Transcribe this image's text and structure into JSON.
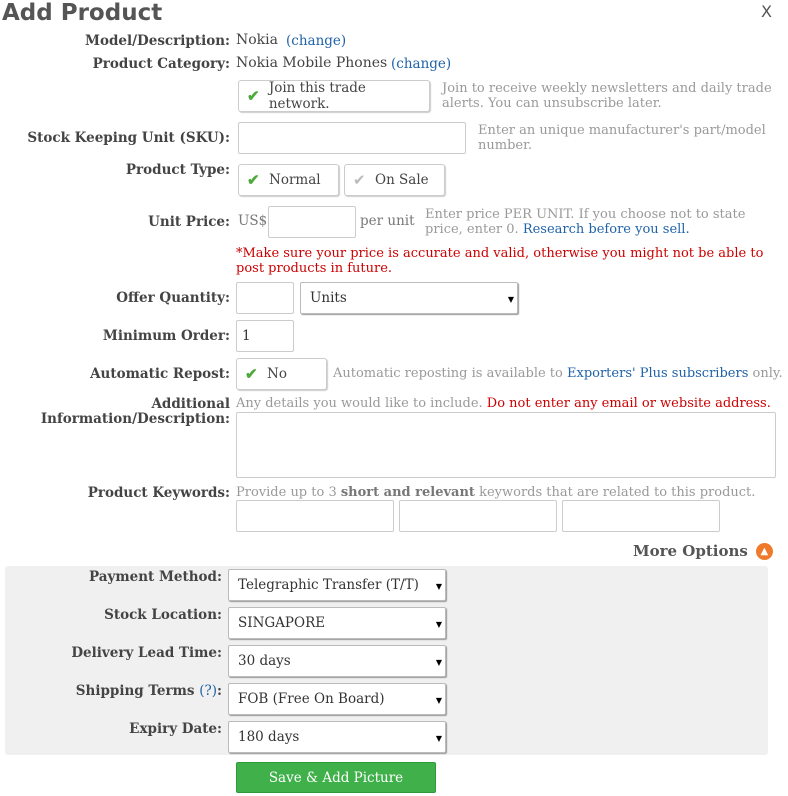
{
  "header": {
    "title": "Add Product",
    "close_label": "X"
  },
  "model": {
    "label": "Model/Description:",
    "value": "Nokia",
    "change": "(change)"
  },
  "category": {
    "label": "Product Category:",
    "value": "Nokia Mobile Phones",
    "change": "(change)"
  },
  "join": {
    "label": "Join this trade network.",
    "hint": "Join to receive weekly newsletters and daily trade alerts. You can unsubscribe later."
  },
  "sku": {
    "label": "Stock Keeping Unit (SKU):",
    "value": "",
    "hint": "Enter an unique manufacturer's part/model number."
  },
  "product_type": {
    "label": "Product Type:",
    "options": [
      "Normal",
      "On Sale"
    ],
    "selected": "Normal"
  },
  "unit_price": {
    "label": "Unit Price:",
    "currency": "US$",
    "value": "",
    "per_unit": "per unit",
    "hint": "Enter price PER UNIT. If you choose not to state price, enter 0.",
    "research_link": "Research before you sell.",
    "warning": "*Make sure your price is accurate and valid, otherwise you might not be able to post products in future."
  },
  "offer_quantity": {
    "label": "Offer Quantity:",
    "value": "",
    "unit": "Units"
  },
  "minimum_order": {
    "label": "Minimum Order:",
    "value": "1"
  },
  "repost": {
    "label": "Automatic Repost:",
    "value": "No",
    "hint_before": "Automatic reposting is available to",
    "link": "Exporters' Plus subscribers",
    "hint_after": "only."
  },
  "additional": {
    "label_line1": "Additional",
    "label_line2": "Information/Description:",
    "hint": "Any details you would like to include.",
    "warning": "Do not enter any email or website address.",
    "value": ""
  },
  "keywords": {
    "label": "Product Keywords:",
    "hint_before": "Provide up to 3",
    "hint_bold": "short and relevant",
    "hint_after": "keywords that are related to this product.",
    "values": [
      "",
      "",
      ""
    ]
  },
  "more_options": {
    "label": "More Options",
    "icon": "chevron-up-icon"
  },
  "payment": {
    "label": "Payment Method:",
    "value": "Telegraphic Transfer (T/T)"
  },
  "stock_location": {
    "label": "Stock Location:",
    "value": "SINGAPORE"
  },
  "lead_time": {
    "label": "Delivery Lead Time:",
    "value": "30 days"
  },
  "shipping": {
    "label": "Shipping Terms",
    "help": "(?)",
    "colon": ":",
    "value": "FOB (Free On Board)"
  },
  "expiry": {
    "label": "Expiry Date:",
    "value": "180 days"
  },
  "submit": {
    "label": "Save & Add Picture"
  },
  "colors": {
    "accent_link": "#1f62a8",
    "save_green": "#3fb04a",
    "warning_red": "#cc0000",
    "more_orange": "#f07a2b"
  }
}
